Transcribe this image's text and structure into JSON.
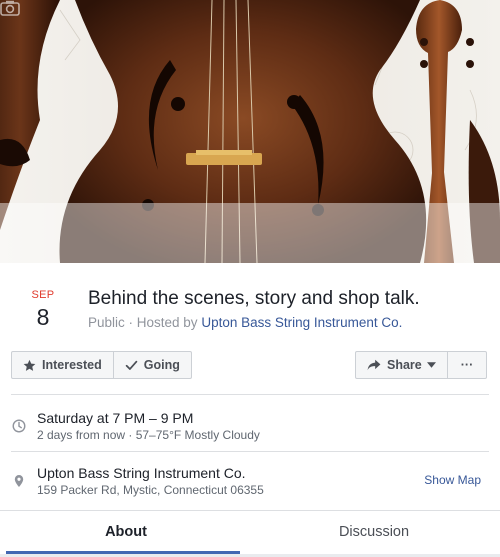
{
  "event": {
    "month": "SEP",
    "day": "8",
    "title": "Behind the scenes, story and shop talk.",
    "visibility": "Public · Hosted by",
    "host": "Upton Bass String Instrument Co."
  },
  "actions": {
    "interested": "Interested",
    "going": "Going",
    "share": "Share",
    "more": "···"
  },
  "details": {
    "time_main": "Saturday at 7 PM – 9 PM",
    "time_sub": "2 days from now · 57–75°F Mostly Cloudy",
    "place_main": "Upton Bass String Instrument Co.",
    "place_sub": "159 Packer Rd, Mystic, Connecticut 06355",
    "show_map": "Show Map"
  },
  "tabs": {
    "about": "About",
    "discussion": "Discussion"
  },
  "icons": {
    "cover_camera": "camera-icon",
    "interested": "star-icon",
    "going": "check-icon",
    "share": "share-arrow-icon",
    "share_caret": "caret-down-icon",
    "time": "clock-icon",
    "location": "map-pin-icon"
  },
  "colors": {
    "accent": "#4267b2",
    "link": "#385898",
    "month": "#e03b2d"
  }
}
